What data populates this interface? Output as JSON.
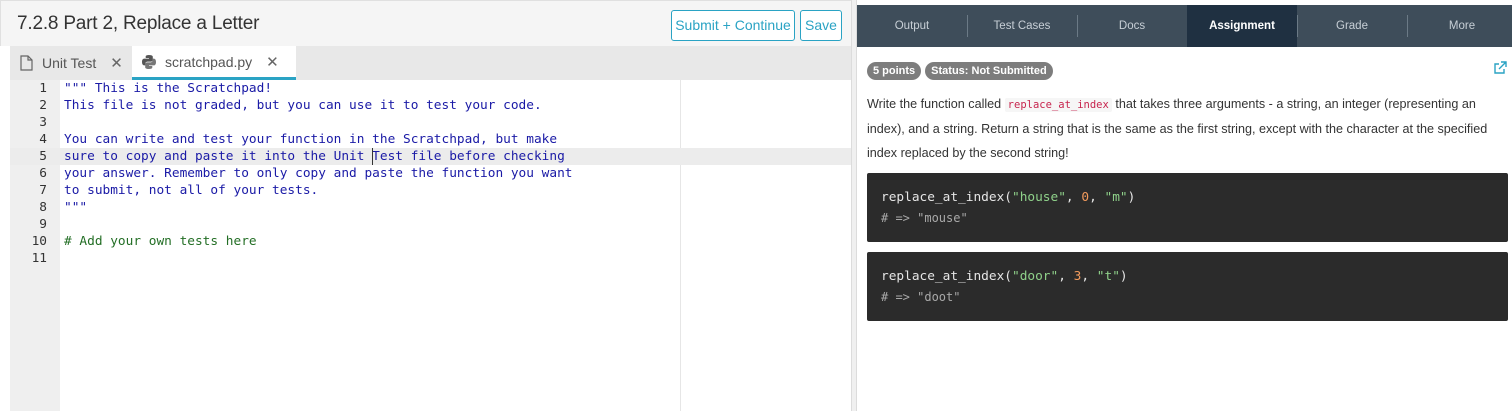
{
  "editor_panel": {
    "title": "7.2.8 Part 2, Replace a Letter",
    "submit_label": "Submit + Continue",
    "save_label": "Save",
    "tabs": [
      {
        "label": "Unit Test",
        "icon": "file-icon"
      },
      {
        "label": "scratchpad.py",
        "icon": "python-icon"
      }
    ],
    "lines": [
      {
        "n": "1",
        "text": "\"\"\" This is the Scratchpad!"
      },
      {
        "n": "2",
        "text": "This file is not graded, but you can use it to test your code."
      },
      {
        "n": "3",
        "text": ""
      },
      {
        "n": "4",
        "text": "You can write and test your function in the Scratchpad, but make"
      },
      {
        "n": "5",
        "text": "sure to copy and paste it into the Unit Test file before checking"
      },
      {
        "n": "6",
        "text": "your answer. Remember to only copy and paste the function you want"
      },
      {
        "n": "7",
        "text": "to submit, not all of your tests."
      },
      {
        "n": "8",
        "text": "\"\"\""
      },
      {
        "n": "9",
        "text": ""
      },
      {
        "n": "10",
        "text": "# Add your own tests here"
      },
      {
        "n": "11",
        "text": ""
      }
    ]
  },
  "assignment_panel": {
    "nav": [
      "Output",
      "Test Cases",
      "Docs",
      "Assignment",
      "Grade",
      "More"
    ],
    "active_nav": "Assignment",
    "points_badge": "5 points",
    "status_badge": "Status: Not Submitted",
    "desc_pre": "Write the function called ",
    "desc_code": "replace_at_index",
    "desc_post": " that takes three arguments - a string, an integer (representing an index), and a string. Return a string that is the same as the first string, except with the character at the specified index replaced by the second string!",
    "examples": [
      {
        "fn": "replace_at_index(",
        "a1": "\"house\"",
        "a2": "0",
        "a3": "\"m\"",
        "result": "# => \"mouse\""
      },
      {
        "fn": "replace_at_index(",
        "a1": "\"door\"",
        "a2": "3",
        "a3": "\"t\"",
        "result": "# => \"doot\""
      }
    ]
  }
}
